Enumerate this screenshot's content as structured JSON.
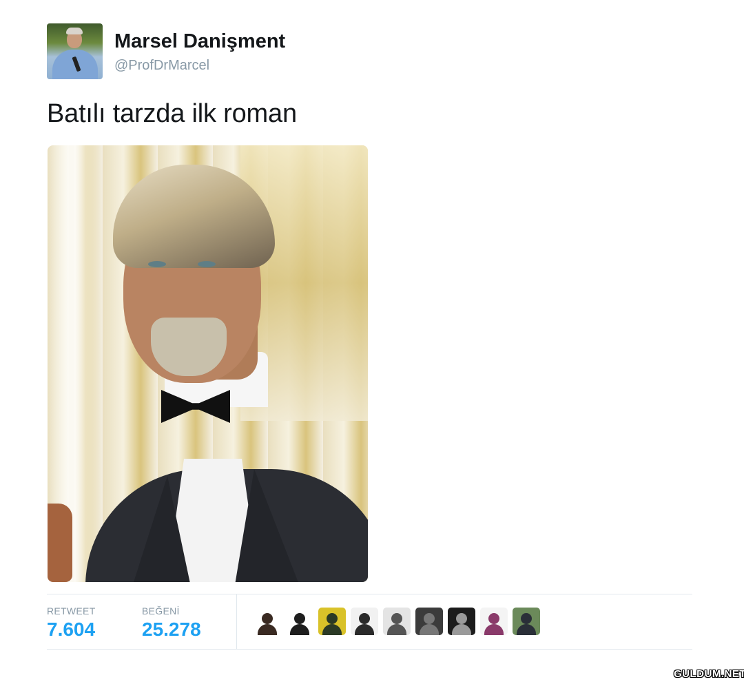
{
  "tweet": {
    "author": {
      "display_name": "Marsel Danişment",
      "handle": "@ProfDrMarcel"
    },
    "text": "Batılı tarzda ilk roman"
  },
  "stats": {
    "retweet_label": "RETWEET",
    "retweet_count": "7.604",
    "like_label": "BEĞENİ",
    "like_count": "25.278"
  },
  "likers": [
    {
      "name": "liker-avatar-1",
      "bg": "#ffffff",
      "fg": "#3a2a22"
    },
    {
      "name": "liker-avatar-2",
      "bg": "#ffffff",
      "fg": "#1e1e1e"
    },
    {
      "name": "liker-avatar-3",
      "bg": "#d9c229",
      "fg": "#2b3a25"
    },
    {
      "name": "liker-avatar-4",
      "bg": "#f1f1f1",
      "fg": "#2a2a2a"
    },
    {
      "name": "liker-avatar-5",
      "bg": "#e4e4e4",
      "fg": "#555555"
    },
    {
      "name": "liker-avatar-6",
      "bg": "#3b3b3b",
      "fg": "#777777"
    },
    {
      "name": "liker-avatar-7",
      "bg": "#1c1c1c",
      "fg": "#9a9a9a"
    },
    {
      "name": "liker-avatar-8",
      "bg": "#f4f4f4",
      "fg": "#8a3a6a"
    },
    {
      "name": "liker-avatar-9",
      "bg": "#6b8a5a",
      "fg": "#2a2f38"
    }
  ],
  "watermark": "GULDUM.NET",
  "colors": {
    "accent": "#1da1f2",
    "muted": "#8899a6",
    "divider": "#e1e8ed"
  }
}
